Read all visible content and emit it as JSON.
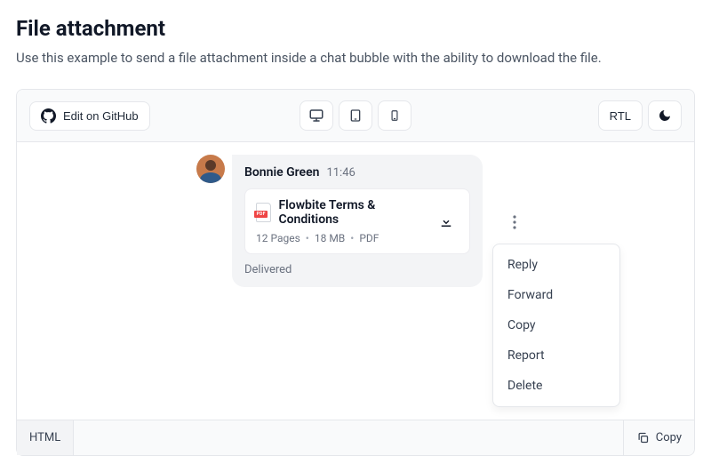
{
  "section": {
    "title": "File attachment",
    "description": "Use this example to send a file attachment inside a chat bubble with the ability to download the file."
  },
  "toolbar": {
    "edit_label": "Edit on GitHub",
    "rtl_label": "RTL"
  },
  "message": {
    "sender": "Bonnie Green",
    "time": "11:46",
    "status": "Delivered"
  },
  "attachment": {
    "name": "Flowbite Terms & Conditions",
    "pages": "12 Pages",
    "size": "18 MB",
    "type_label": "PDF"
  },
  "menu": {
    "items": [
      "Reply",
      "Forward",
      "Copy",
      "Report",
      "Delete"
    ]
  },
  "footer": {
    "tab_label": "HTML",
    "copy_label": "Copy"
  }
}
